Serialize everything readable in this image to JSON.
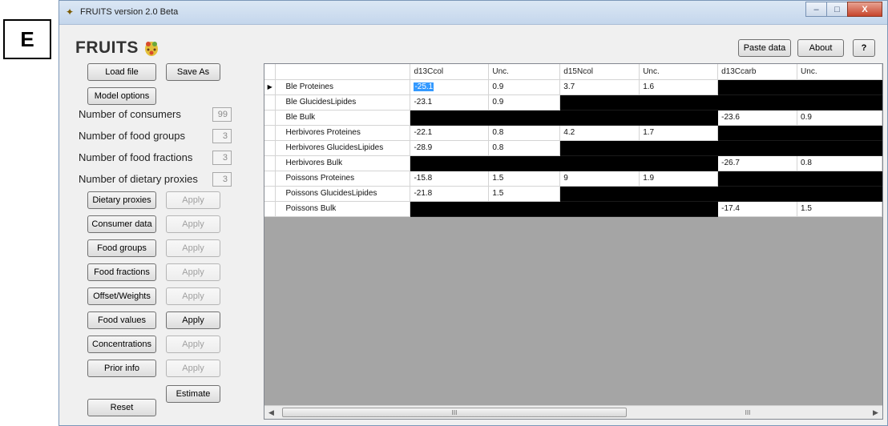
{
  "figure_label": "E",
  "window": {
    "title": "FRUITS version 2.0 Beta",
    "app_icon": "fruits-logo-icon",
    "controls": {
      "minimize": "–",
      "maximize": "□",
      "close": "X"
    }
  },
  "header": {
    "brand": "FRUITS",
    "paste_data": "Paste data",
    "about": "About",
    "help": "?"
  },
  "left_panel": {
    "load_file": "Load file",
    "save_as": "Save As",
    "model_options": "Model options",
    "counts": [
      {
        "label": "Number of consumers",
        "value": "99"
      },
      {
        "label": "Number of food groups",
        "value": "3"
      },
      {
        "label": "Number of food fractions",
        "value": "3"
      },
      {
        "label": "Number of dietary proxies",
        "value": "3"
      }
    ],
    "sections": [
      {
        "label": "Dietary proxies",
        "apply": "Apply",
        "apply_enabled": false
      },
      {
        "label": "Consumer data",
        "apply": "Apply",
        "apply_enabled": false
      },
      {
        "label": "Food groups",
        "apply": "Apply",
        "apply_enabled": false
      },
      {
        "label": "Food fractions",
        "apply": "Apply",
        "apply_enabled": false
      },
      {
        "label": "Offset/Weights",
        "apply": "Apply",
        "apply_enabled": false
      },
      {
        "label": "Food values",
        "apply": "Apply",
        "apply_enabled": true
      },
      {
        "label": "Concentrations",
        "apply": "Apply",
        "apply_enabled": false
      },
      {
        "label": "Prior info",
        "apply": "Apply",
        "apply_enabled": false
      }
    ],
    "estimate": "Estimate",
    "reset": "Reset"
  },
  "grid": {
    "columns": [
      "d13Ccol",
      "Unc.",
      "d15Ncol",
      "Unc.",
      "d13Ccarb",
      "Unc."
    ],
    "rows": [
      {
        "name": "Ble Proteines",
        "cells": [
          "-25.1",
          "0.9",
          "3.7",
          "1.6",
          null,
          null
        ],
        "current": true
      },
      {
        "name": "Ble GlucidesLipides",
        "cells": [
          "-23.1",
          "0.9",
          null,
          null,
          null,
          null
        ]
      },
      {
        "name": "Ble Bulk",
        "cells": [
          null,
          null,
          null,
          null,
          "-23.6",
          "0.9"
        ]
      },
      {
        "name": "Herbivores Proteines",
        "cells": [
          "-22.1",
          "0.8",
          "4.2",
          "1.7",
          null,
          null
        ]
      },
      {
        "name": "Herbivores GlucidesLipides",
        "cells": [
          "-28.9",
          "0.8",
          null,
          null,
          null,
          null
        ]
      },
      {
        "name": "Herbivores Bulk",
        "cells": [
          null,
          null,
          null,
          null,
          "-26.7",
          "0.8"
        ]
      },
      {
        "name": "Poissons Proteines",
        "cells": [
          "-15.8",
          "1.5",
          "9",
          "1.9",
          null,
          null
        ]
      },
      {
        "name": "Poissons GlucidesLipides",
        "cells": [
          "-21.8",
          "1.5",
          null,
          null,
          null,
          null
        ]
      },
      {
        "name": "Poissons Bulk",
        "cells": [
          null,
          null,
          null,
          null,
          "-17.4",
          "1.5"
        ]
      }
    ],
    "scroll_thumb_glyph": "III"
  }
}
